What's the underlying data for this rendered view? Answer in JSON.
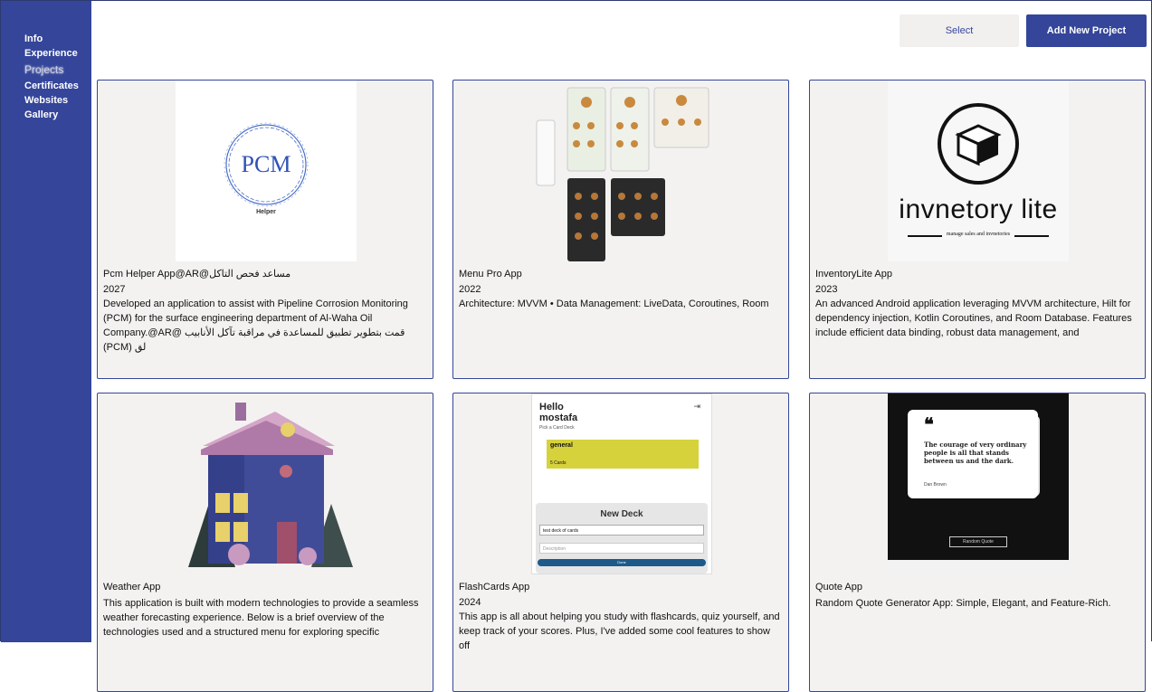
{
  "sidebar": {
    "items": [
      {
        "label": "Info"
      },
      {
        "label": "Experience"
      },
      {
        "label": "Projects",
        "active": true
      },
      {
        "label": "Certificates"
      },
      {
        "label": "Websites"
      },
      {
        "label": "Gallery"
      }
    ]
  },
  "toolbar": {
    "select_label": "Select",
    "add_label": "Add New Project"
  },
  "projects": [
    {
      "title": "Pcm Helper App@AR@مساعد فحص التاكل",
      "year": "2027",
      "description": "Developed an application to assist with Pipeline Corrosion Monitoring (PCM) for the surface engineering department of Al-Waha Oil Company.@AR@ قمت بتطوير تطبيق للمساعدة في مراقبة تآكل الأنابيب (PCM) لق",
      "logo_text": "PCM",
      "logo_sub": "Helper"
    },
    {
      "title": "Menu Pro App",
      "year": "2022",
      "description": "Architecture: MVVM • Data Management: LiveData, Coroutines, Room"
    },
    {
      "title": "InventoryLite App",
      "year": "2023",
      "description": "An advanced Android application leveraging MVVM architecture, Hilt for dependency injection, Kotlin Coroutines, and Room Database. Features include efficient data binding, robust data management, and",
      "logo_text": "invnetory lite",
      "logo_sub": "manage sales and invnetories"
    },
    {
      "title": "Weather App",
      "description": "This application is built with modern technologies to provide a seamless weather forecasting experience. Below is a brief overview of the technologies used and a structured menu for exploring specific"
    },
    {
      "title": "FlashCards App",
      "year": "2024",
      "description": "This app is all about helping you study with flashcards, quiz yourself, and keep track of your scores. Plus, I've added some cool features to show off",
      "shot": {
        "greeting": "Hello",
        "name": "mostafa",
        "sub": "Pick a Card Deck",
        "deck": "general",
        "count": "5 Cards",
        "modal": "New Deck",
        "input": "test deck of cards",
        "desc_placeholder": "Description",
        "button": "Done"
      }
    },
    {
      "title": "Quote App",
      "description": "Random Quote Generator App: Simple, Elegant, and Feature-Rich.",
      "shot": {
        "quote": "The courage of very ordinary people is all that stands between us and the dark.",
        "author": "Dan Brown",
        "button": "Random Quote"
      }
    }
  ],
  "colors": {
    "sidebar": "#34459a",
    "card_bg": "#f3f2f1",
    "accent": "#34459a"
  }
}
